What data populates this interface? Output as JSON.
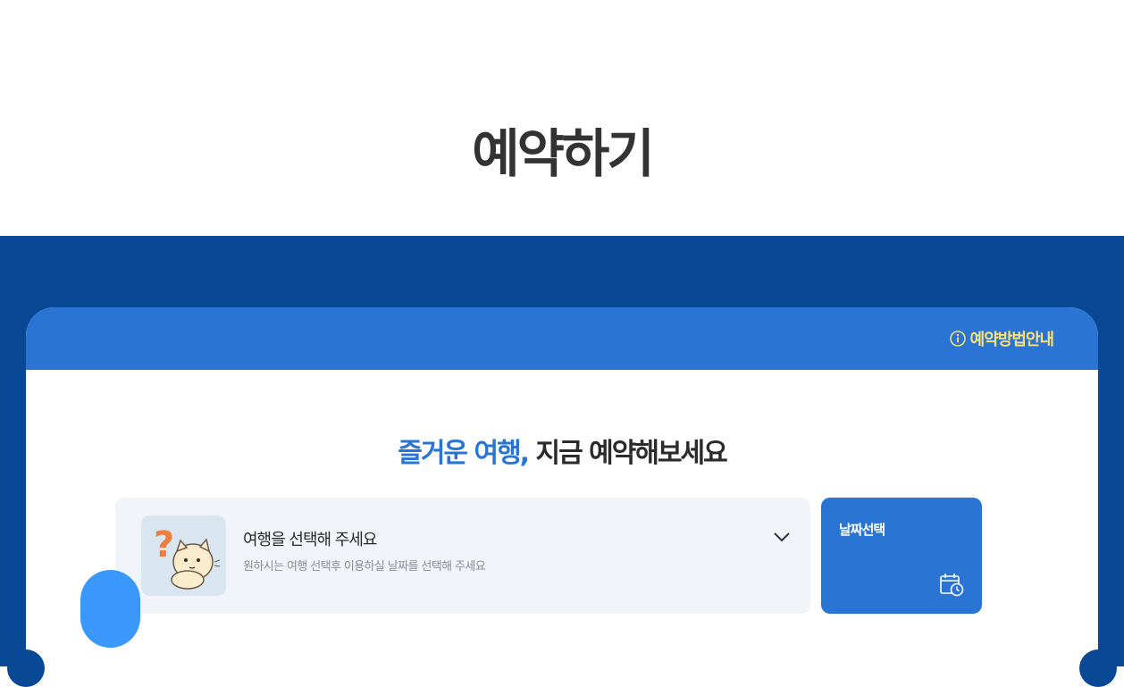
{
  "page": {
    "title": "예약하기"
  },
  "card": {
    "guide_link": "예약방법안내",
    "headline_highlight": "즐거운 여행,",
    "headline_rest": "지금 예약해보세요"
  },
  "trip_selector": {
    "title": "여행을 선택해 주세요",
    "subtitle": "원하시는 여행 선택후 이용하실 날짜를 선택해 주세요"
  },
  "date_picker": {
    "label": "날짜선택"
  },
  "icons": {
    "guide": "info-circle-icon",
    "selector_thumb": "question-cat-icon",
    "dropdown": "chevron-down-icon",
    "date": "calendar-clock-icon"
  },
  "colors": {
    "band": "#084894",
    "accent": "#2a75d3",
    "guide_text": "#f8e07a",
    "fab": "#3b98fb",
    "selector_bg": "#f1f4f8"
  }
}
